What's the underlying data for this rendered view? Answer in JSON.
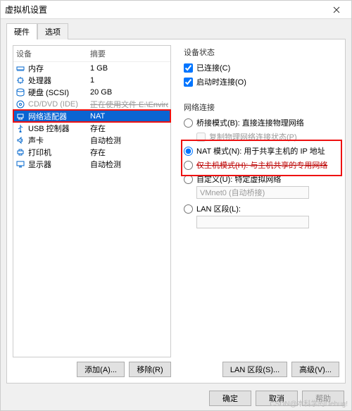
{
  "window": {
    "title": "虚拟机设置",
    "close": "×"
  },
  "tabs": {
    "hardware": "硬件",
    "options": "选项"
  },
  "left": {
    "header_device": "设备",
    "header_summary": "摘要",
    "rows": [
      {
        "name": "内存",
        "summary": "1 GB",
        "icon": "memory"
      },
      {
        "name": "处理器",
        "summary": "1",
        "icon": "cpu"
      },
      {
        "name": "硬盘 (SCSI)",
        "summary": "20 GB",
        "icon": "disk"
      },
      {
        "name": "CD/DVD (IDE)",
        "summary": "正在使用文件 E:\\Environmen...",
        "icon": "cd",
        "struck": true,
        "disabled": true
      },
      {
        "name": "网络适配器",
        "summary": "NAT",
        "icon": "net",
        "sel": true,
        "hl": true
      },
      {
        "name": "USB 控制器",
        "summary": "存在",
        "icon": "usb"
      },
      {
        "name": "声卡",
        "summary": "自动检测",
        "icon": "sound"
      },
      {
        "name": "打印机",
        "summary": "存在",
        "icon": "printer"
      },
      {
        "name": "显示器",
        "summary": "自动检测",
        "icon": "display"
      }
    ],
    "add_btn": "添加(A)...",
    "remove_btn": "移除(R)"
  },
  "right": {
    "device_status": "设备状态",
    "connected": "已连接(C)",
    "connect_at_power": "启动时连接(O)",
    "network_conn": "网络连接",
    "bridged": "桥接模式(B): 直接连接物理网络",
    "copy_phys": "复制物理网络连接状态(P)",
    "nat": "NAT 模式(N): 用于共享主机的 IP 地址",
    "hostonly": "仅主机模式(H): 与主机共享的专用网络",
    "custom": "自定义(U): 特定虚拟网络",
    "vmnet0": "VMnet0 (自动桥接)",
    "lanseg": "LAN 区段(L):",
    "lanseg_btn": "LAN 区段(S)...",
    "advanced_btn": "高级(V)..."
  },
  "buttons": {
    "ok": "确定",
    "cancel": "取消",
    "help": "帮助"
  },
  "watermark": "CSDN@本科学的Debug!"
}
